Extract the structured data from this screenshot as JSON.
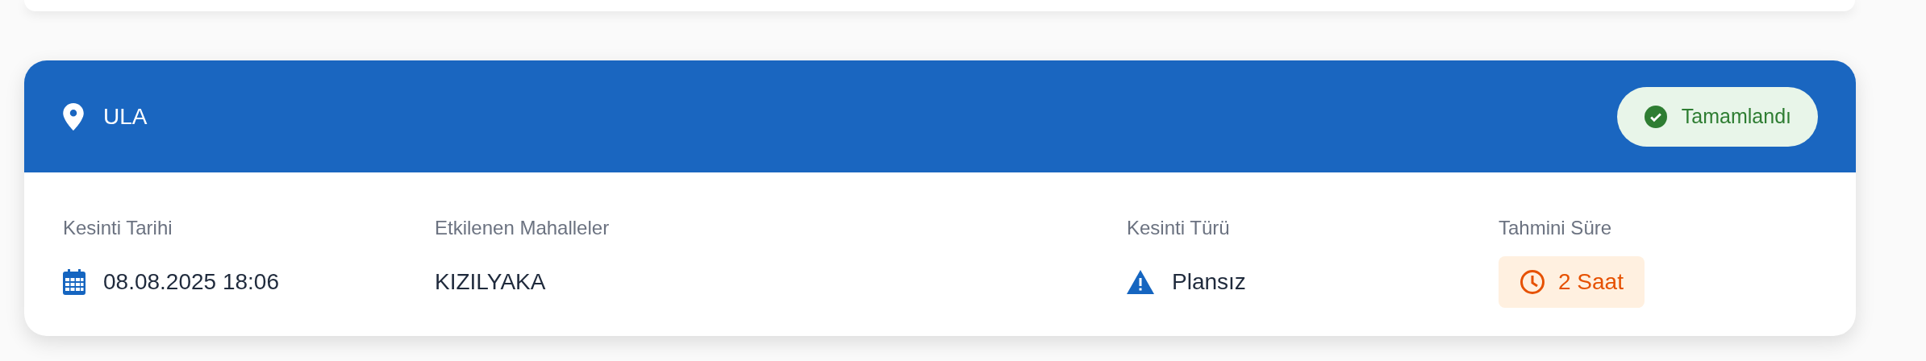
{
  "location": "ULA",
  "status": {
    "label": "Tamamlandı",
    "kind": "completed"
  },
  "fields": [
    {
      "label": "Kesinti Tarihi",
      "value": "08.08.2025 18:06",
      "kind": "date"
    },
    {
      "label": "Etkilenen Mahalleler",
      "value": "KIZILYAKA",
      "kind": "plain"
    },
    {
      "label": "Kesinti Türü",
      "value": "Plansız",
      "kind": "warning"
    },
    {
      "label": "Tahmini Süre",
      "value": "2 Saat",
      "kind": "duration"
    }
  ]
}
